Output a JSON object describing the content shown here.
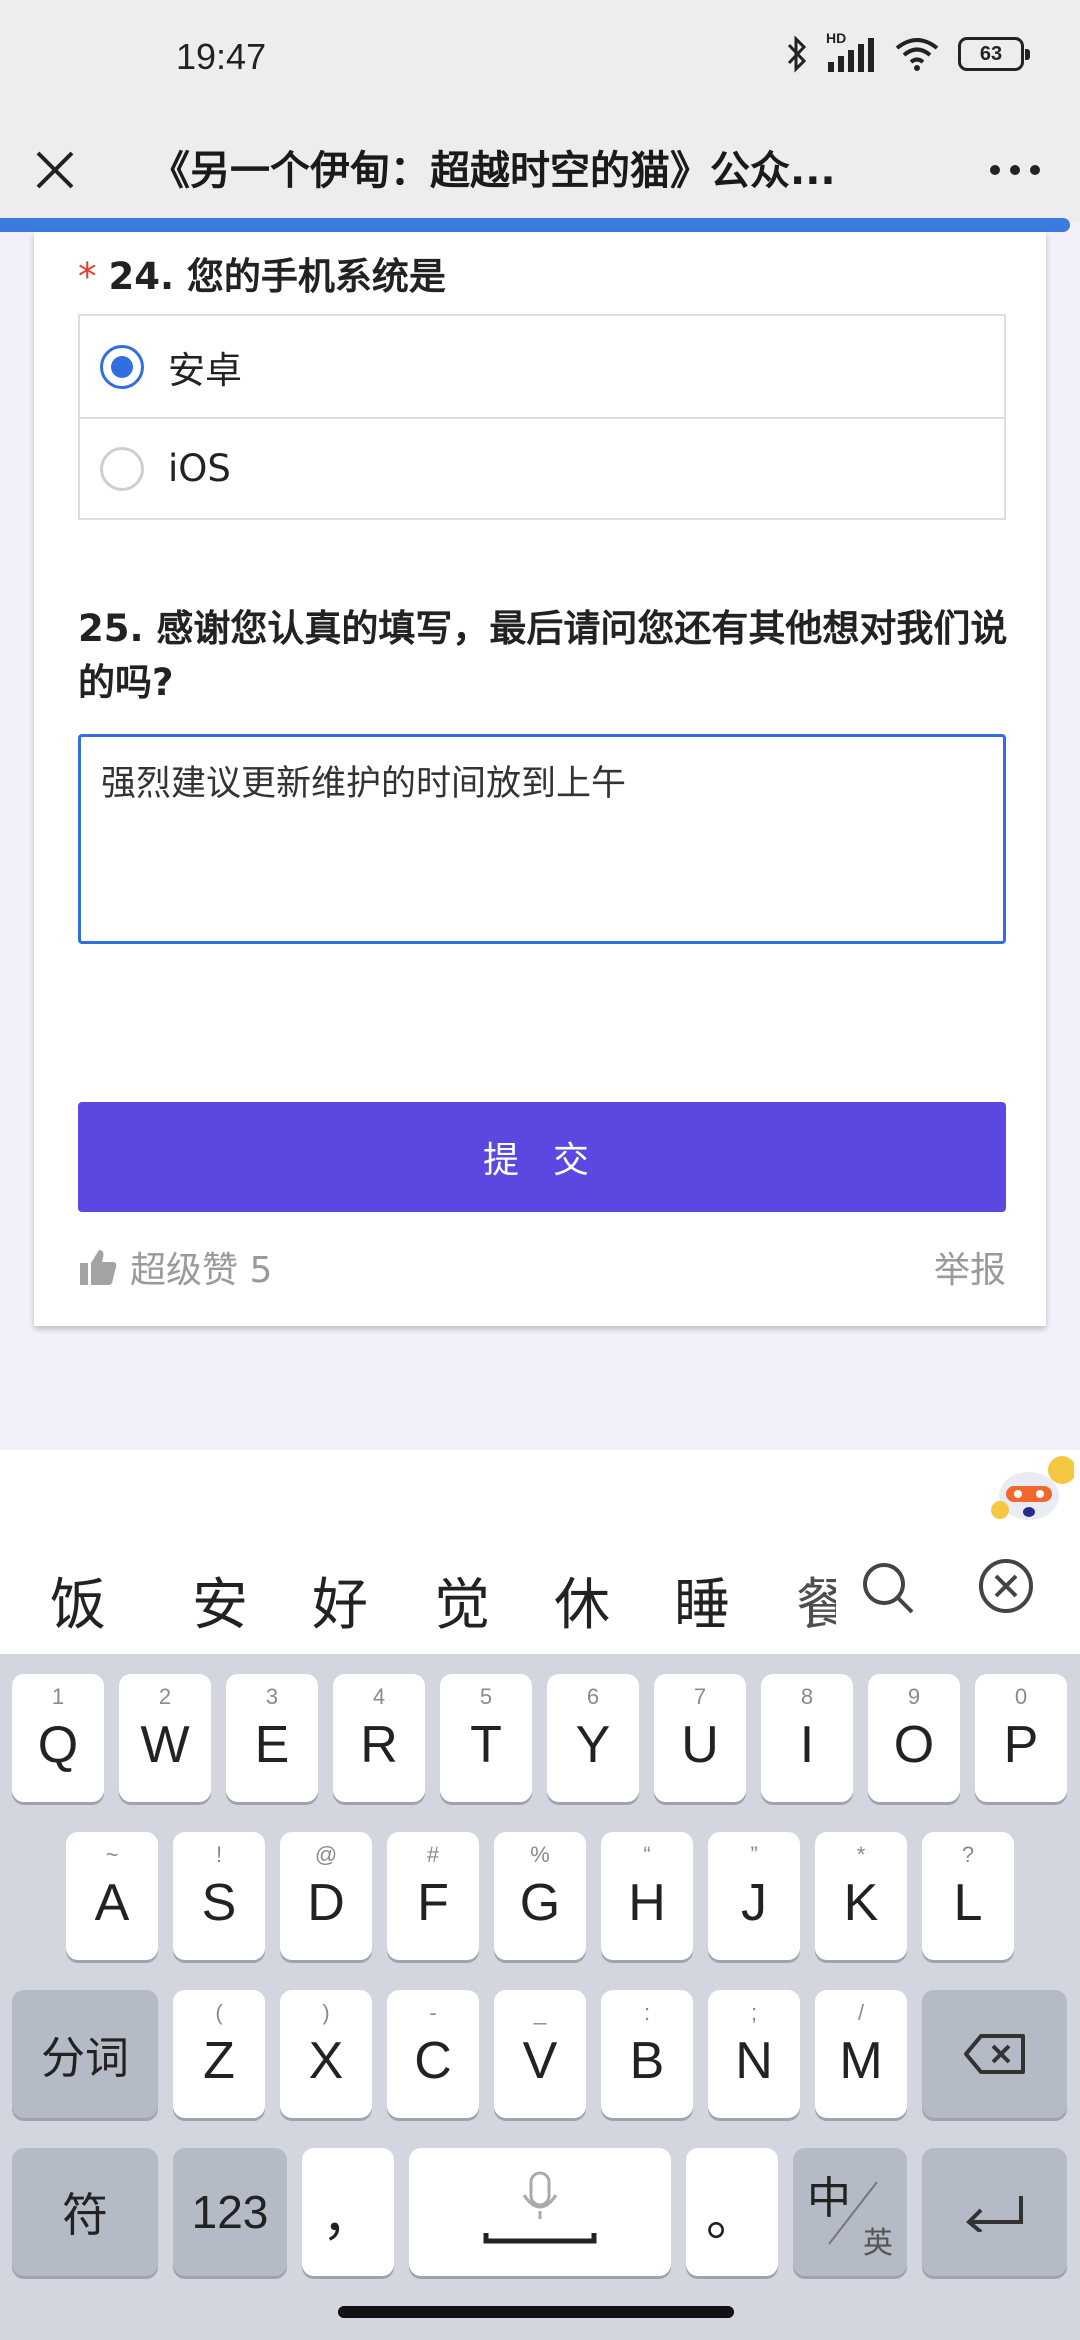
{
  "status": {
    "time": "19:47",
    "battery": "63",
    "network": "HD"
  },
  "nav": {
    "title": "《另一个伊甸：超越时空的猫》公众..."
  },
  "q24": {
    "number_title": "24. 您的手机系统是",
    "required_mark": "*",
    "options": [
      {
        "label": "安卓",
        "selected": true
      },
      {
        "label": "iOS",
        "selected": false
      }
    ]
  },
  "q25": {
    "title": "25. 感谢您认真的填写，最后请问您还有其他想对我们说的吗?",
    "value": "强烈建议更新维护的时间放到上午"
  },
  "submit": {
    "label": "提 交"
  },
  "footer": {
    "like_text": "超级赞 5",
    "report": "举报"
  },
  "ime": {
    "candidates": [
      "饭",
      "安",
      "好",
      "觉",
      "休",
      "睡",
      "餐"
    ],
    "row1": [
      [
        "1",
        "Q"
      ],
      [
        "2",
        "W"
      ],
      [
        "3",
        "E"
      ],
      [
        "4",
        "R"
      ],
      [
        "5",
        "T"
      ],
      [
        "6",
        "Y"
      ],
      [
        "7",
        "U"
      ],
      [
        "8",
        "I"
      ],
      [
        "9",
        "O"
      ],
      [
        "0",
        "P"
      ]
    ],
    "row2": [
      [
        "~",
        "A"
      ],
      [
        "!",
        "S"
      ],
      [
        "@",
        "D"
      ],
      [
        "#",
        "F"
      ],
      [
        "%",
        "G"
      ],
      [
        "“",
        "H"
      ],
      [
        "”",
        "J"
      ],
      [
        "*",
        "K"
      ],
      [
        "?",
        "L"
      ]
    ],
    "row3": [
      [
        "(",
        "Z"
      ],
      [
        ")",
        "X"
      ],
      [
        "-",
        "C"
      ],
      [
        "_",
        "V"
      ],
      [
        ":",
        "B"
      ],
      [
        ";",
        "N"
      ],
      [
        "/",
        "M"
      ]
    ],
    "segment_label": "分词",
    "symbol_label": "符",
    "num_label": "123",
    "comma": "，",
    "period": "。",
    "lang_main": "中",
    "lang_sub": "英"
  }
}
